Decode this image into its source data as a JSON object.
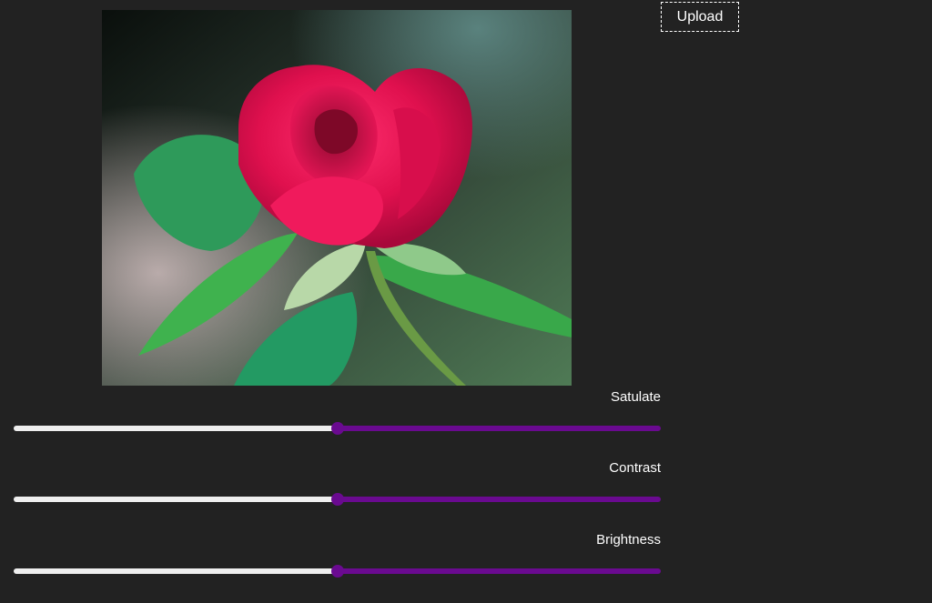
{
  "toolbar": {
    "upload_label": "Upload"
  },
  "preview": {
    "subject": "rose-photo"
  },
  "controls": [
    {
      "label": "Satulate",
      "value": 0.5
    },
    {
      "label": "Contrast",
      "value": 0.5
    },
    {
      "label": "Brightness",
      "value": 0.5
    }
  ],
  "colors": {
    "background": "#222222",
    "slider_fill": "#efefef",
    "slider_accent": "#6a0a90"
  }
}
